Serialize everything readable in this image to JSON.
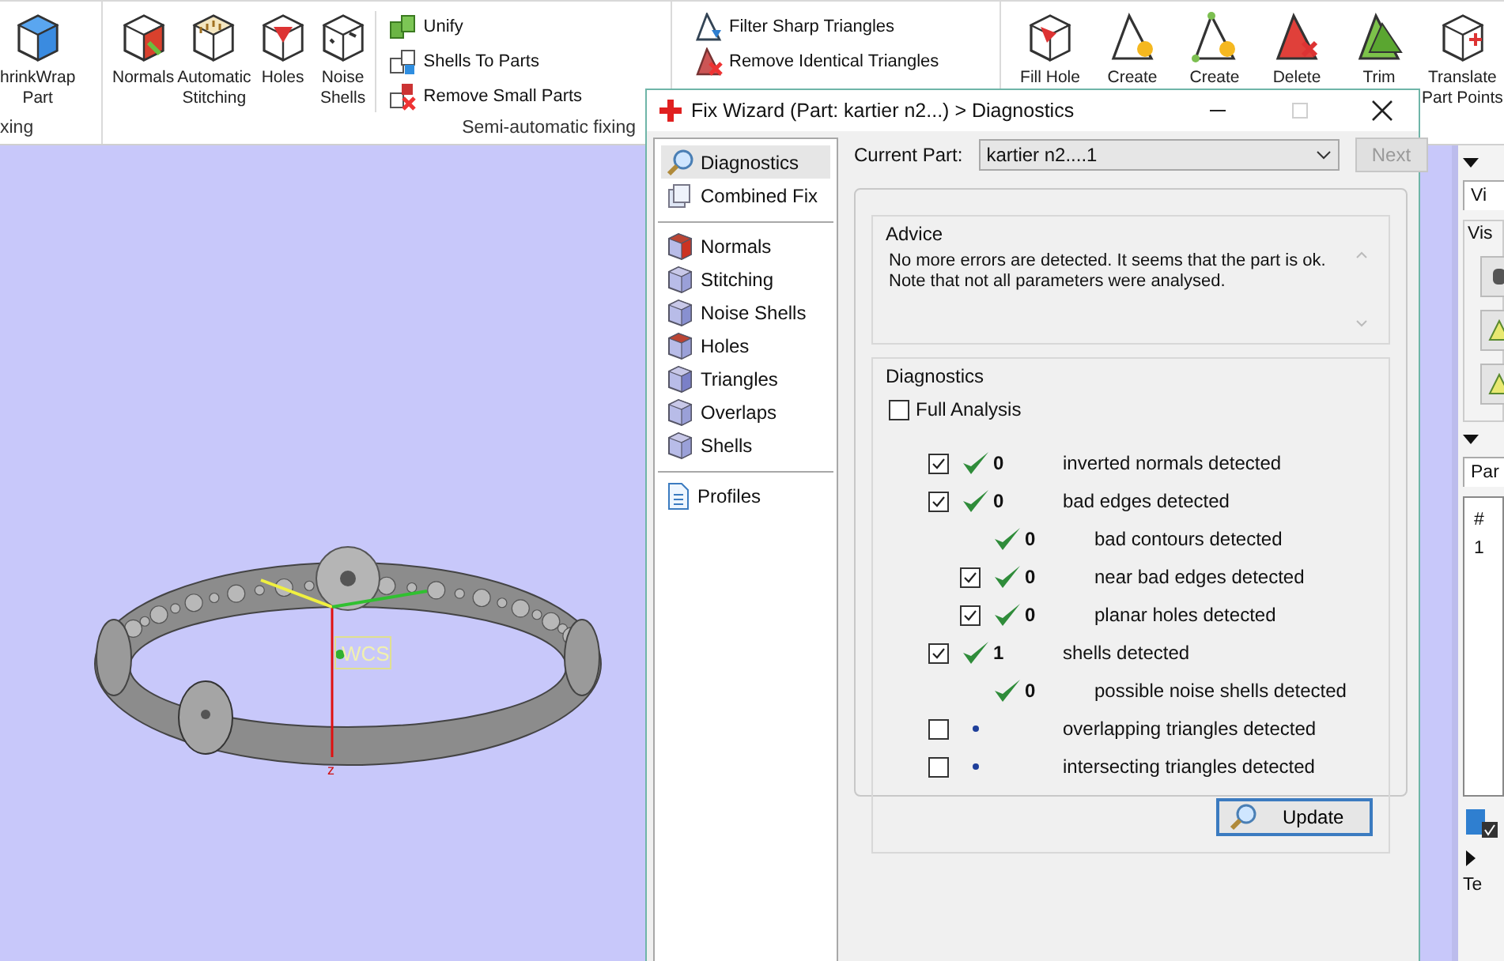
{
  "ribbon": {
    "groups": [
      {
        "label": "xing",
        "items": [
          {
            "kind": "large",
            "label": "hrinkWrap\nPart"
          }
        ]
      },
      {
        "label": "Semi-automatic fixing",
        "items": [
          {
            "kind": "large",
            "label": "Normals"
          },
          {
            "kind": "large",
            "label": "Automatic\nStitching"
          },
          {
            "kind": "large",
            "label": "Holes"
          },
          {
            "kind": "large",
            "label": "Noise\nShells"
          },
          {
            "kind": "small",
            "label": "Unify"
          },
          {
            "kind": "small",
            "label": "Shells To Parts"
          },
          {
            "kind": "small",
            "label": "Remove Small Parts"
          }
        ]
      },
      {
        "items": [
          {
            "kind": "small",
            "label": "Filter Sharp Triangles"
          },
          {
            "kind": "small",
            "label": "Remove Identical Triangles"
          }
        ]
      },
      {
        "items": [
          {
            "kind": "large",
            "label": "Fill Hole"
          },
          {
            "kind": "large",
            "label": "Create"
          },
          {
            "kind": "large",
            "label": "Create"
          },
          {
            "kind": "large",
            "label": "Delete"
          },
          {
            "kind": "large",
            "label": "Trim"
          },
          {
            "kind": "large",
            "label": "Translate\nPart Points"
          }
        ]
      }
    ]
  },
  "viewport": {
    "wcs_label": "WCS",
    "axis_label": "z"
  },
  "side_panel": {
    "tab_1": "Vi",
    "group_1": "Vis",
    "tab_2": "Par",
    "list_header": "#",
    "list_row": "1",
    "tab_3": "Te"
  },
  "dialog": {
    "title": "Fix Wizard (Part: kartier n2...) > Diagnostics",
    "window_controls": [
      {
        "kind": "minimize",
        "disabled": false
      },
      {
        "kind": "maximize",
        "disabled": true
      },
      {
        "kind": "close",
        "disabled": false
      }
    ],
    "nav_sections": [
      {
        "items": [
          {
            "label": "Diagnostics",
            "selected": true
          },
          {
            "label": "Combined Fix",
            "selected": false
          }
        ]
      },
      {
        "items": [
          {
            "label": "Normals",
            "selected": false
          },
          {
            "label": "Stitching",
            "selected": false
          },
          {
            "label": "Noise Shells",
            "selected": false
          },
          {
            "label": "Holes",
            "selected": false
          },
          {
            "label": "Triangles",
            "selected": false
          },
          {
            "label": "Overlaps",
            "selected": false
          },
          {
            "label": "Shells",
            "selected": false
          }
        ]
      },
      {
        "items": [
          {
            "label": "Profiles",
            "selected": false
          }
        ]
      }
    ],
    "current_part": {
      "label": "Current Part:",
      "value": "kartier n2....1"
    },
    "next_button": {
      "label": "Next",
      "disabled": true
    },
    "advice": {
      "title": "Advice",
      "text": "No more errors are detected. It seems that the part is ok.\nNote that not all parameters were analysed."
    },
    "diagnostics": {
      "title": "Diagnostics",
      "full_analysis": {
        "label": "Full Analysis",
        "checked": false
      },
      "rows": [
        {
          "checked": true,
          "kind": "ok",
          "count": "0",
          "label": "inverted normals detected"
        },
        {
          "checked": true,
          "kind": "ok",
          "count": "0",
          "label": "bad edges detected",
          "children": [
            {
              "kind": "ok",
              "count": "0",
              "label": "bad contours detected"
            },
            {
              "checked": true,
              "kind": "ok",
              "count": "0",
              "label": "near bad edges detected"
            },
            {
              "checked": true,
              "kind": "ok",
              "count": "0",
              "label": "planar holes detected"
            }
          ]
        },
        {
          "checked": true,
          "kind": "ok",
          "count": "1",
          "label": "shells detected",
          "children": [
            {
              "kind": "ok",
              "count": "0",
              "label": "possible noise shells detected"
            }
          ]
        },
        {
          "checked": false,
          "kind": "pending",
          "label": "overlapping triangles detected"
        },
        {
          "checked": false,
          "kind": "pending",
          "label": "intersecting triangles detected"
        }
      ],
      "update_button": "Update"
    }
  }
}
